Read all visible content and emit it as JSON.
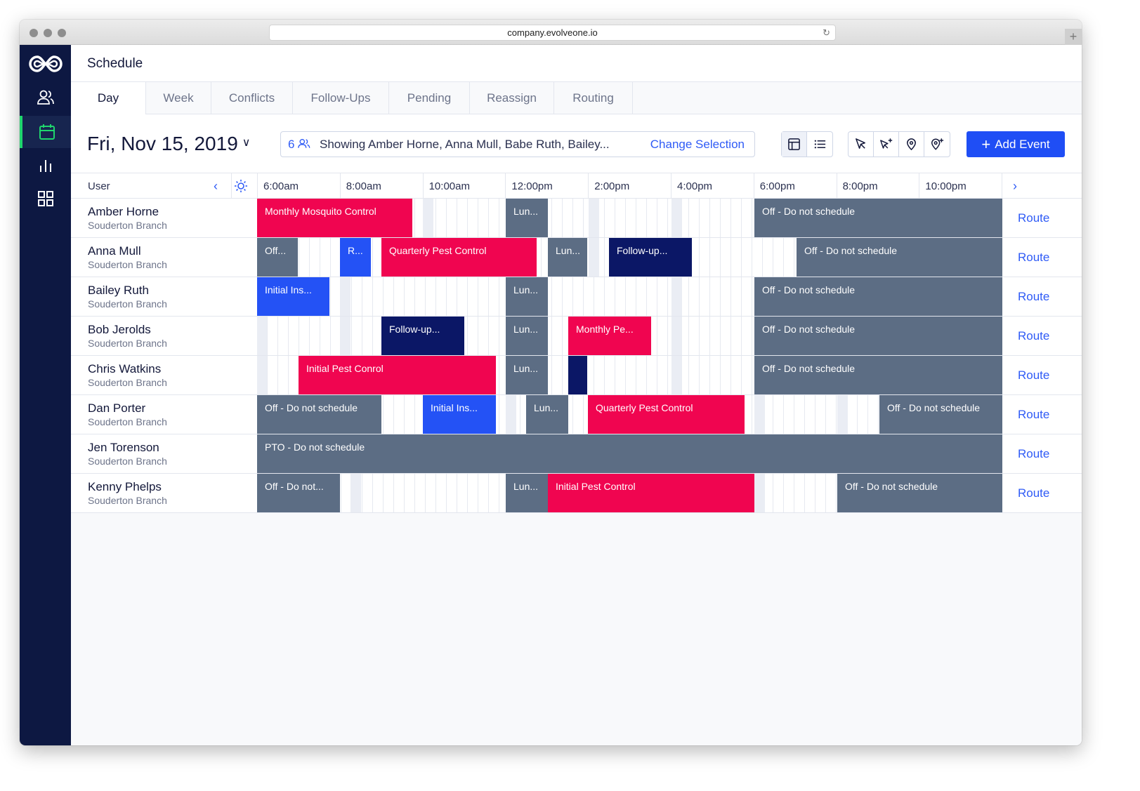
{
  "browser": {
    "url": "company.evolveone.io",
    "new_tab": "+"
  },
  "sidebar": {
    "items": [
      {
        "name": "logo",
        "icon": "infinity-logo-icon"
      },
      {
        "name": "people",
        "icon": "people-icon"
      },
      {
        "name": "schedule",
        "icon": "calendar-icon",
        "active": true
      },
      {
        "name": "reports",
        "icon": "bar-chart-icon"
      },
      {
        "name": "apps",
        "icon": "grid-icon"
      }
    ],
    "active_color": "#1fd66d",
    "bg_color": "#0d1842"
  },
  "header": {
    "title": "Schedule"
  },
  "tabs": [
    {
      "label": "Day",
      "active": true
    },
    {
      "label": "Week"
    },
    {
      "label": "Conflicts"
    },
    {
      "label": "Follow-Ups"
    },
    {
      "label": "Pending"
    },
    {
      "label": "Reassign"
    },
    {
      "label": "Routing"
    }
  ],
  "toolbar": {
    "date": "Fri, Nov 15, 2019",
    "selection_count": "6",
    "selection_text": "Showing Amber Horne, Anna Mull, Babe Ruth, Bailey...",
    "change_selection": "Change Selection",
    "add_event": "Add Event",
    "accent": "#1f4ef5"
  },
  "grid": {
    "user_header": "User",
    "times": [
      "6:00am",
      "8:00am",
      "10:00am",
      "12:00pm",
      "2:00pm",
      "4:00pm",
      "6:00pm",
      "8:00pm",
      "10:00pm"
    ],
    "route_label": "Route"
  },
  "rows": [
    {
      "name": "Amber Horne",
      "branch": "Souderton Branch",
      "events": [
        {
          "label": "Monthly Mosquito Control",
          "type": "red"
        },
        {
          "label": "Lun...",
          "type": "grey"
        },
        {
          "label": "Off - Do not schedule",
          "type": "grey"
        }
      ]
    },
    {
      "name": "Anna Mull",
      "branch": "Souderton Branch",
      "events": [
        {
          "label": "Off...",
          "type": "grey"
        },
        {
          "label": "R...",
          "type": "blue"
        },
        {
          "label": "Quarterly Pest Control",
          "type": "red"
        },
        {
          "label": "Lun...",
          "type": "grey"
        },
        {
          "label": "Follow-up...",
          "type": "navy"
        },
        {
          "label": "Off - Do not schedule",
          "type": "grey"
        }
      ]
    },
    {
      "name": "Bailey Ruth",
      "branch": "Souderton Branch",
      "events": [
        {
          "label": "Initial Ins...",
          "type": "blue"
        },
        {
          "label": "Lun...",
          "type": "grey"
        },
        {
          "label": "Off - Do not schedule",
          "type": "grey"
        }
      ]
    },
    {
      "name": "Bob Jerolds",
      "branch": "Souderton Branch",
      "events": [
        {
          "label": "Follow-up...",
          "type": "navy"
        },
        {
          "label": "Lun...",
          "type": "grey"
        },
        {
          "label": "Monthly Pe...",
          "type": "red"
        },
        {
          "label": "Off - Do not schedule",
          "type": "grey"
        }
      ]
    },
    {
      "name": "Chris Watkins",
      "branch": "Souderton Branch",
      "events": [
        {
          "label": "Initial Pest Conrol",
          "type": "red"
        },
        {
          "label": "Lun...",
          "type": "grey"
        },
        {
          "label": "",
          "type": "navy"
        },
        {
          "label": "Off - Do not schedule",
          "type": "grey"
        }
      ]
    },
    {
      "name": "Dan Porter",
      "branch": "Souderton Branch",
      "events": [
        {
          "label": "Off - Do not schedule",
          "type": "grey"
        },
        {
          "label": "Initial Ins...",
          "type": "blue"
        },
        {
          "label": "Lun...",
          "type": "grey"
        },
        {
          "label": "Quarterly Pest Control",
          "type": "red"
        },
        {
          "label": "Off - Do not schedule",
          "type": "grey"
        }
      ]
    },
    {
      "name": "Jen Torenson",
      "branch": "Souderton Branch",
      "events": [
        {
          "label": "PTO - Do not schedule",
          "type": "grey"
        }
      ]
    },
    {
      "name": "Kenny Phelps",
      "branch": "Souderton Branch",
      "events": [
        {
          "label": "Off - Do not...",
          "type": "grey"
        },
        {
          "label": "Lun...",
          "type": "grey"
        },
        {
          "label": "Initial Pest Control",
          "type": "red"
        },
        {
          "label": "Off - Do not schedule",
          "type": "grey"
        }
      ]
    }
  ],
  "colors": {
    "red": "#f00550",
    "grey": "#5c6d84",
    "blue": "#2452f5",
    "navy": "#0b1766",
    "link": "#2f5bf6"
  }
}
